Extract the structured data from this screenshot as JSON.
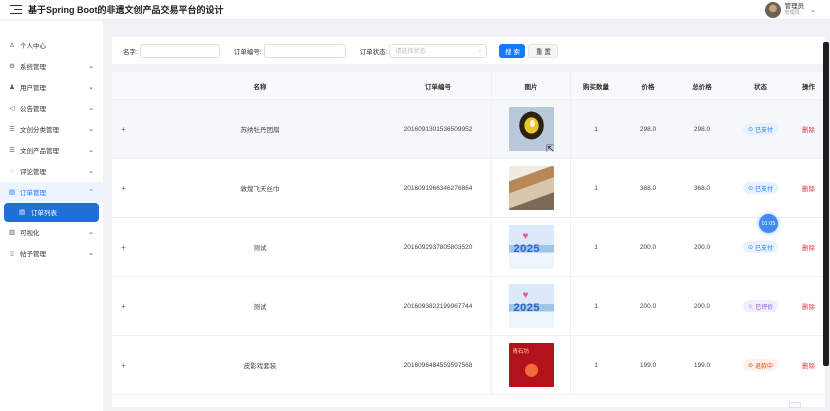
{
  "header": {
    "title": "基于Spring Boot的非遗文创产品交易平台的设计",
    "user_name": "管理员",
    "user_role": "管理员"
  },
  "sidebar": {
    "items": [
      {
        "label": "个人中心",
        "icon": "user-icon",
        "glyph": "♙"
      },
      {
        "label": "系统管理",
        "icon": "gear-icon",
        "glyph": "⚙"
      },
      {
        "label": "用户管理",
        "icon": "users-icon",
        "glyph": "♟"
      },
      {
        "label": "公告管理",
        "icon": "megaphone-icon",
        "glyph": "◁"
      },
      {
        "label": "文创分类管理",
        "icon": "list-icon",
        "glyph": "☰"
      },
      {
        "label": "文创产品管理",
        "icon": "list-icon",
        "glyph": "☰"
      },
      {
        "label": "评论管理",
        "icon": "comment-icon",
        "glyph": "◌"
      },
      {
        "label": "订单管理",
        "icon": "document-icon",
        "glyph": "▤"
      },
      {
        "label": "可视化",
        "icon": "bar-chart-icon",
        "glyph": "▥"
      },
      {
        "label": "帖子管理",
        "icon": "post-icon",
        "glyph": "▯"
      }
    ],
    "active_sub": {
      "label": "订单列表",
      "glyph": "▤"
    }
  },
  "filters": {
    "name_label": "名字:",
    "order_label": "订单编号:",
    "status_label": "订单状态:",
    "status_placeholder": "请选择状态",
    "search_button": "搜 索",
    "reset_button": "重 置"
  },
  "table": {
    "columns": [
      "名称",
      "订单编号",
      "图片",
      "购买数量",
      "价格",
      "总价格",
      "状态",
      "操作"
    ],
    "rows": [
      {
        "expand": "+",
        "name": "苏绣牡丹团扇",
        "order_no": "2016091301536509952",
        "qty": "1",
        "price": "298.0",
        "total": "298.0",
        "status": "已支付",
        "status_glyph": "⊙",
        "action": "删除"
      },
      {
        "expand": "+",
        "name": "敦煌飞天丝巾",
        "order_no": "2016091966346276864",
        "qty": "1",
        "price": "368.0",
        "total": "368.0",
        "status": "已支付",
        "status_glyph": "⊙",
        "action": "删除"
      },
      {
        "expand": "+",
        "name": "测试",
        "order_no": "2016092937805803520",
        "qty": "1",
        "price": "200.0",
        "total": "200.0",
        "status": "已支付",
        "status_glyph": "⊙",
        "action": "删除"
      },
      {
        "expand": "+",
        "name": "测试",
        "order_no": "2016093822199967744",
        "qty": "1",
        "price": "200.0",
        "total": "200.0",
        "status": "已评价",
        "status_glyph": "☆",
        "action": "删除"
      },
      {
        "expand": "+",
        "name": "皮影戏套装",
        "order_no": "2016096484559597568",
        "qty": "1",
        "price": "199.0",
        "total": "199.0",
        "status": "退款中",
        "status_glyph": "⊘",
        "action": "删除"
      }
    ],
    "thumb_texts": {
      "year": "2025",
      "heart": "♥",
      "brand": "青石坊"
    }
  },
  "overlay": {
    "timer": "01:05"
  },
  "colors": {
    "primary": "#1677ff",
    "danger": "#e33b3b",
    "refund": "#e0531f",
    "reviewed": "#7a4ee0"
  }
}
